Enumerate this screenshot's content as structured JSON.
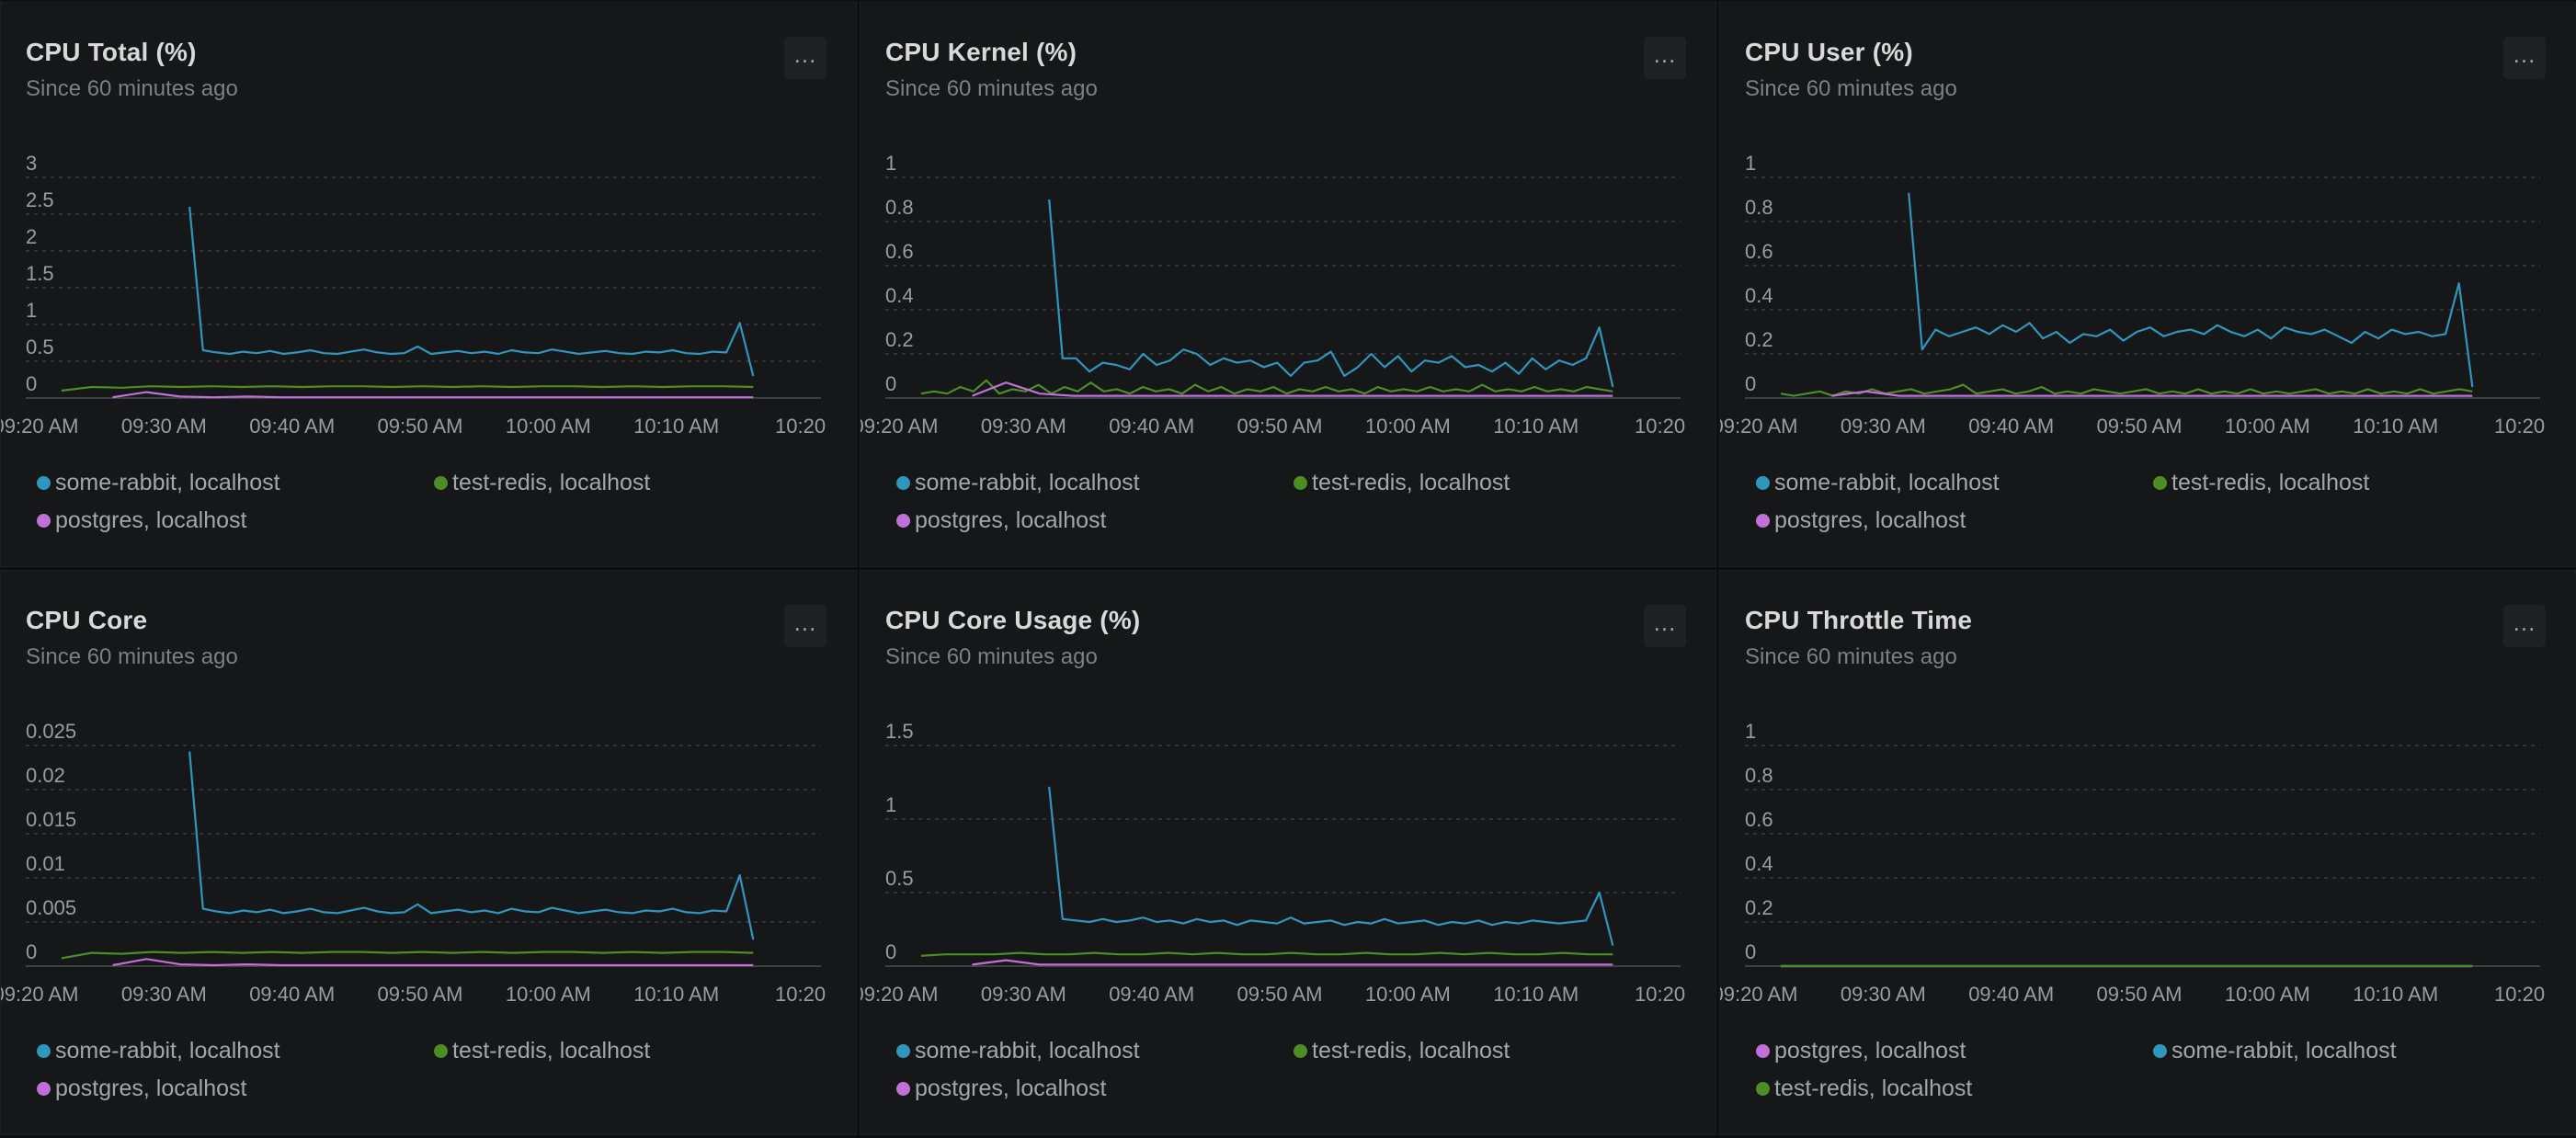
{
  "common": {
    "subtitle": "Since 60 minutes ago",
    "menu_label": "...",
    "x_ticks": [
      "09:20 AM",
      "09:30 AM",
      "09:40 AM",
      "09:50 AM",
      "10:00 AM",
      "10:10 AM",
      "10:20"
    ],
    "colors": {
      "some-rabbit": "#2f96bd",
      "test-redis": "#4e8d23",
      "postgres": "#c16fd9",
      "grid": "#3a3c3f",
      "axis": "#3d3f42",
      "tick_text": "#9a9da0"
    }
  },
  "chart_data": [
    {
      "type": "line",
      "title": "CPU Total (%)",
      "subtitle": "Since 60 minutes ago",
      "y_ticks": [
        "3",
        "2.5",
        "2",
        "1.5",
        "1",
        "0.5",
        "0"
      ],
      "ylim": [
        0,
        3
      ],
      "x_range": [
        "09:17 AM",
        "10:21 AM"
      ],
      "grid": true,
      "legend_position": "bottom",
      "legend": [
        "some-rabbit, localhost",
        "test-redis, localhost",
        "postgres, localhost"
      ],
      "series": [
        {
          "name": "some-rabbit, localhost",
          "color": "#2f96bd",
          "x_start": "09:32",
          "x_end": "10:16",
          "values": [
            2.6,
            0.65,
            0.62,
            0.6,
            0.63,
            0.61,
            0.64,
            0.6,
            0.62,
            0.65,
            0.61,
            0.6,
            0.63,
            0.66,
            0.62,
            0.6,
            0.61,
            0.7,
            0.6,
            0.62,
            0.64,
            0.61,
            0.63,
            0.6,
            0.65,
            0.62,
            0.61,
            0.66,
            0.63,
            0.6,
            0.62,
            0.64,
            0.61,
            0.6,
            0.63,
            0.62,
            0.65,
            0.61,
            0.6,
            0.63,
            0.62,
            1.02,
            0.3
          ]
        },
        {
          "name": "test-redis, localhost",
          "color": "#4e8d23",
          "x_start": "09:22",
          "x_end": "10:16",
          "values": [
            0.1,
            0.15,
            0.14,
            0.16,
            0.15,
            0.16,
            0.15,
            0.16,
            0.15,
            0.16,
            0.16,
            0.15,
            0.16,
            0.15,
            0.16,
            0.15,
            0.16,
            0.16,
            0.15,
            0.16,
            0.15,
            0.16,
            0.16,
            0.15
          ]
        },
        {
          "name": "postgres, localhost",
          "color": "#c16fd9",
          "x_start": "09:26",
          "x_end": "10:16",
          "values": [
            0.01,
            0.08,
            0.02,
            0.01,
            0.02,
            0.01,
            0.01,
            0.01,
            0.01,
            0.01,
            0.01,
            0.01,
            0.01,
            0.01,
            0.01,
            0.01,
            0.01,
            0.01,
            0.01,
            0.01
          ]
        }
      ]
    },
    {
      "type": "line",
      "title": "CPU Kernel (%)",
      "subtitle": "Since 60 minutes ago",
      "y_ticks": [
        "1",
        "0.8",
        "0.6",
        "0.4",
        "0.2",
        "0"
      ],
      "ylim": [
        0,
        1
      ],
      "x_range": [
        "09:17 AM",
        "10:21 AM"
      ],
      "grid": true,
      "legend_position": "bottom",
      "legend": [
        "some-rabbit, localhost",
        "test-redis, localhost",
        "postgres, localhost"
      ],
      "series": [
        {
          "name": "some-rabbit, localhost",
          "color": "#2f96bd",
          "x_start": "09:32",
          "x_end": "10:16",
          "values": [
            0.9,
            0.18,
            0.18,
            0.12,
            0.16,
            0.15,
            0.13,
            0.2,
            0.15,
            0.17,
            0.22,
            0.2,
            0.15,
            0.18,
            0.16,
            0.17,
            0.14,
            0.16,
            0.1,
            0.16,
            0.17,
            0.21,
            0.1,
            0.14,
            0.2,
            0.14,
            0.19,
            0.12,
            0.17,
            0.16,
            0.19,
            0.14,
            0.15,
            0.12,
            0.16,
            0.11,
            0.18,
            0.13,
            0.17,
            0.15,
            0.18,
            0.32,
            0.05
          ]
        },
        {
          "name": "test-redis, localhost",
          "color": "#4e8d23",
          "x_start": "09:22",
          "x_end": "10:16",
          "values": [
            0.02,
            0.03,
            0.02,
            0.05,
            0.03,
            0.08,
            0.02,
            0.04,
            0.03,
            0.06,
            0.02,
            0.05,
            0.03,
            0.07,
            0.03,
            0.04,
            0.02,
            0.05,
            0.03,
            0.04,
            0.02,
            0.06,
            0.03,
            0.05,
            0.02,
            0.04,
            0.03,
            0.05,
            0.02,
            0.04,
            0.03,
            0.05,
            0.03,
            0.04,
            0.02,
            0.05,
            0.03,
            0.04,
            0.03,
            0.05,
            0.03,
            0.04,
            0.03,
            0.06,
            0.03,
            0.04,
            0.03,
            0.05,
            0.03,
            0.04,
            0.03,
            0.05,
            0.04,
            0.03
          ]
        },
        {
          "name": "postgres, localhost",
          "color": "#c16fd9",
          "x_start": "09:26",
          "x_end": "10:16",
          "values": [
            0.01,
            0.07,
            0.02,
            0.01,
            0.01,
            0.01,
            0.01,
            0.01,
            0.01,
            0.01,
            0.01,
            0.01,
            0.01,
            0.01,
            0.01,
            0.01,
            0.01,
            0.01,
            0.01,
            0.01
          ]
        }
      ]
    },
    {
      "type": "line",
      "title": "CPU User (%)",
      "subtitle": "Since 60 minutes ago",
      "y_ticks": [
        "1",
        "0.8",
        "0.6",
        "0.4",
        "0.2",
        "0"
      ],
      "ylim": [
        0,
        1
      ],
      "x_range": [
        "09:17 AM",
        "10:21 AM"
      ],
      "grid": true,
      "legend_position": "bottom",
      "legend": [
        "some-rabbit, localhost",
        "test-redis, localhost",
        "postgres, localhost"
      ],
      "series": [
        {
          "name": "some-rabbit, localhost",
          "color": "#2f96bd",
          "x_start": "09:32",
          "x_end": "10:16",
          "values": [
            0.93,
            0.22,
            0.31,
            0.28,
            0.3,
            0.32,
            0.29,
            0.33,
            0.3,
            0.34,
            0.27,
            0.3,
            0.25,
            0.29,
            0.28,
            0.31,
            0.26,
            0.3,
            0.32,
            0.28,
            0.3,
            0.31,
            0.29,
            0.33,
            0.3,
            0.28,
            0.31,
            0.27,
            0.32,
            0.3,
            0.29,
            0.31,
            0.28,
            0.25,
            0.3,
            0.27,
            0.31,
            0.29,
            0.3,
            0.28,
            0.29,
            0.52,
            0.05
          ]
        },
        {
          "name": "test-redis, localhost",
          "color": "#4e8d23",
          "x_start": "09:22",
          "x_end": "10:16",
          "values": [
            0.02,
            0.01,
            0.02,
            0.03,
            0.01,
            0.03,
            0.02,
            0.04,
            0.02,
            0.03,
            0.04,
            0.02,
            0.03,
            0.04,
            0.06,
            0.02,
            0.03,
            0.04,
            0.02,
            0.03,
            0.05,
            0.02,
            0.03,
            0.02,
            0.04,
            0.03,
            0.02,
            0.03,
            0.04,
            0.02,
            0.03,
            0.02,
            0.04,
            0.02,
            0.03,
            0.02,
            0.04,
            0.02,
            0.03,
            0.02,
            0.03,
            0.04,
            0.02,
            0.03,
            0.02,
            0.04,
            0.02,
            0.03,
            0.02,
            0.04,
            0.02,
            0.03,
            0.04,
            0.03
          ]
        },
        {
          "name": "postgres, localhost",
          "color": "#c16fd9",
          "x_start": "09:26",
          "x_end": "10:16",
          "values": [
            0.01,
            0.03,
            0.01,
            0.01,
            0.01,
            0.01,
            0.01,
            0.01,
            0.01,
            0.01,
            0.01,
            0.01,
            0.01,
            0.01,
            0.01,
            0.01,
            0.01,
            0.01,
            0.01,
            0.01
          ]
        }
      ]
    },
    {
      "type": "line",
      "title": "CPU Core",
      "subtitle": "Since 60 minutes ago",
      "y_ticks": [
        "0.025",
        "0.02",
        "0.015",
        "0.01",
        "0.005",
        "0"
      ],
      "ylim": [
        0,
        0.025
      ],
      "x_range": [
        "09:17 AM",
        "10:21 AM"
      ],
      "grid": true,
      "legend_position": "bottom",
      "legend": [
        "some-rabbit, localhost",
        "test-redis, localhost",
        "postgres, localhost"
      ],
      "series": [
        {
          "name": "some-rabbit, localhost",
          "color": "#2f96bd",
          "x_start": "09:32",
          "x_end": "10:16",
          "values": [
            0.0243,
            0.0065,
            0.0062,
            0.006,
            0.0063,
            0.0061,
            0.0064,
            0.006,
            0.0062,
            0.0065,
            0.0061,
            0.006,
            0.0063,
            0.0066,
            0.0062,
            0.006,
            0.0061,
            0.007,
            0.006,
            0.0062,
            0.0064,
            0.0061,
            0.0063,
            0.006,
            0.0065,
            0.0062,
            0.0061,
            0.0066,
            0.0063,
            0.006,
            0.0062,
            0.0064,
            0.0061,
            0.006,
            0.0063,
            0.0062,
            0.0065,
            0.0061,
            0.006,
            0.0063,
            0.0062,
            0.0103,
            0.003
          ]
        },
        {
          "name": "test-redis, localhost",
          "color": "#4e8d23",
          "x_start": "09:22",
          "x_end": "10:16",
          "values": [
            0.0009,
            0.0015,
            0.0014,
            0.0016,
            0.0015,
            0.0016,
            0.0015,
            0.0016,
            0.0015,
            0.0016,
            0.0016,
            0.0015,
            0.0016,
            0.0015,
            0.0016,
            0.0015,
            0.0016,
            0.0016,
            0.0015,
            0.0016,
            0.0015,
            0.0016,
            0.0016,
            0.0015
          ]
        },
        {
          "name": "postgres, localhost",
          "color": "#c16fd9",
          "x_start": "09:26",
          "x_end": "10:16",
          "values": [
            0.0001,
            0.0008,
            0.0002,
            0.0001,
            0.0002,
            0.0001,
            0.0001,
            0.0001,
            0.0001,
            0.0001,
            0.0001,
            0.0001,
            0.0001,
            0.0001,
            0.0001,
            0.0001,
            0.0001,
            0.0001,
            0.0001,
            0.0001
          ]
        }
      ]
    },
    {
      "type": "line",
      "title": "CPU Core Usage (%)",
      "subtitle": "Since 60 minutes ago",
      "y_ticks": [
        "1.5",
        "1",
        "0.5",
        "0"
      ],
      "ylim": [
        0,
        1.5
      ],
      "x_range": [
        "09:17 AM",
        "10:21 AM"
      ],
      "grid": true,
      "legend_position": "bottom",
      "legend": [
        "some-rabbit, localhost",
        "test-redis, localhost",
        "postgres, localhost"
      ],
      "series": [
        {
          "name": "some-rabbit, localhost",
          "color": "#2f96bd",
          "x_start": "09:32",
          "x_end": "10:16",
          "values": [
            1.22,
            0.32,
            0.31,
            0.3,
            0.32,
            0.3,
            0.31,
            0.33,
            0.3,
            0.31,
            0.29,
            0.32,
            0.3,
            0.31,
            0.28,
            0.31,
            0.3,
            0.29,
            0.33,
            0.29,
            0.3,
            0.31,
            0.28,
            0.3,
            0.29,
            0.32,
            0.29,
            0.3,
            0.31,
            0.28,
            0.3,
            0.29,
            0.31,
            0.28,
            0.3,
            0.29,
            0.31,
            0.3,
            0.29,
            0.3,
            0.31,
            0.5,
            0.14
          ]
        },
        {
          "name": "test-redis, localhost",
          "color": "#4e8d23",
          "x_start": "09:22",
          "x_end": "10:16",
          "values": [
            0.07,
            0.08,
            0.08,
            0.08,
            0.09,
            0.08,
            0.08,
            0.09,
            0.08,
            0.08,
            0.09,
            0.08,
            0.09,
            0.08,
            0.08,
            0.09,
            0.08,
            0.08,
            0.09,
            0.08,
            0.08,
            0.09,
            0.08,
            0.09,
            0.08,
            0.08,
            0.09,
            0.08,
            0.08
          ]
        },
        {
          "name": "postgres, localhost",
          "color": "#c16fd9",
          "x_start": "09:26",
          "x_end": "10:16",
          "values": [
            0.01,
            0.04,
            0.01,
            0.01,
            0.01,
            0.01,
            0.01,
            0.01,
            0.01,
            0.01,
            0.01,
            0.01,
            0.01,
            0.01,
            0.01,
            0.01,
            0.01,
            0.01,
            0.01,
            0.01
          ]
        }
      ]
    },
    {
      "type": "line",
      "title": "CPU Throttle Time",
      "subtitle": "Since 60 minutes ago",
      "y_ticks": [
        "1",
        "0.8",
        "0.6",
        "0.4",
        "0.2",
        "0"
      ],
      "ylim": [
        0,
        1
      ],
      "x_range": [
        "09:17 AM",
        "10:21 AM"
      ],
      "grid": true,
      "legend_position": "bottom",
      "legend": [
        "postgres, localhost",
        "some-rabbit, localhost",
        "test-redis, localhost"
      ],
      "series": [
        {
          "name": "postgres, localhost",
          "color": "#c16fd9",
          "x_start": "09:22",
          "x_end": "10:16",
          "values": [
            0,
            0,
            0,
            0,
            0
          ]
        },
        {
          "name": "some-rabbit, localhost",
          "color": "#2f96bd",
          "x_start": "09:22",
          "x_end": "10:16",
          "values": [
            0,
            0,
            0,
            0,
            0
          ]
        },
        {
          "name": "test-redis, localhost",
          "color": "#4e8d23",
          "x_start": "09:22",
          "x_end": "10:16",
          "values": [
            0,
            0,
            0,
            0,
            0
          ]
        }
      ]
    }
  ]
}
